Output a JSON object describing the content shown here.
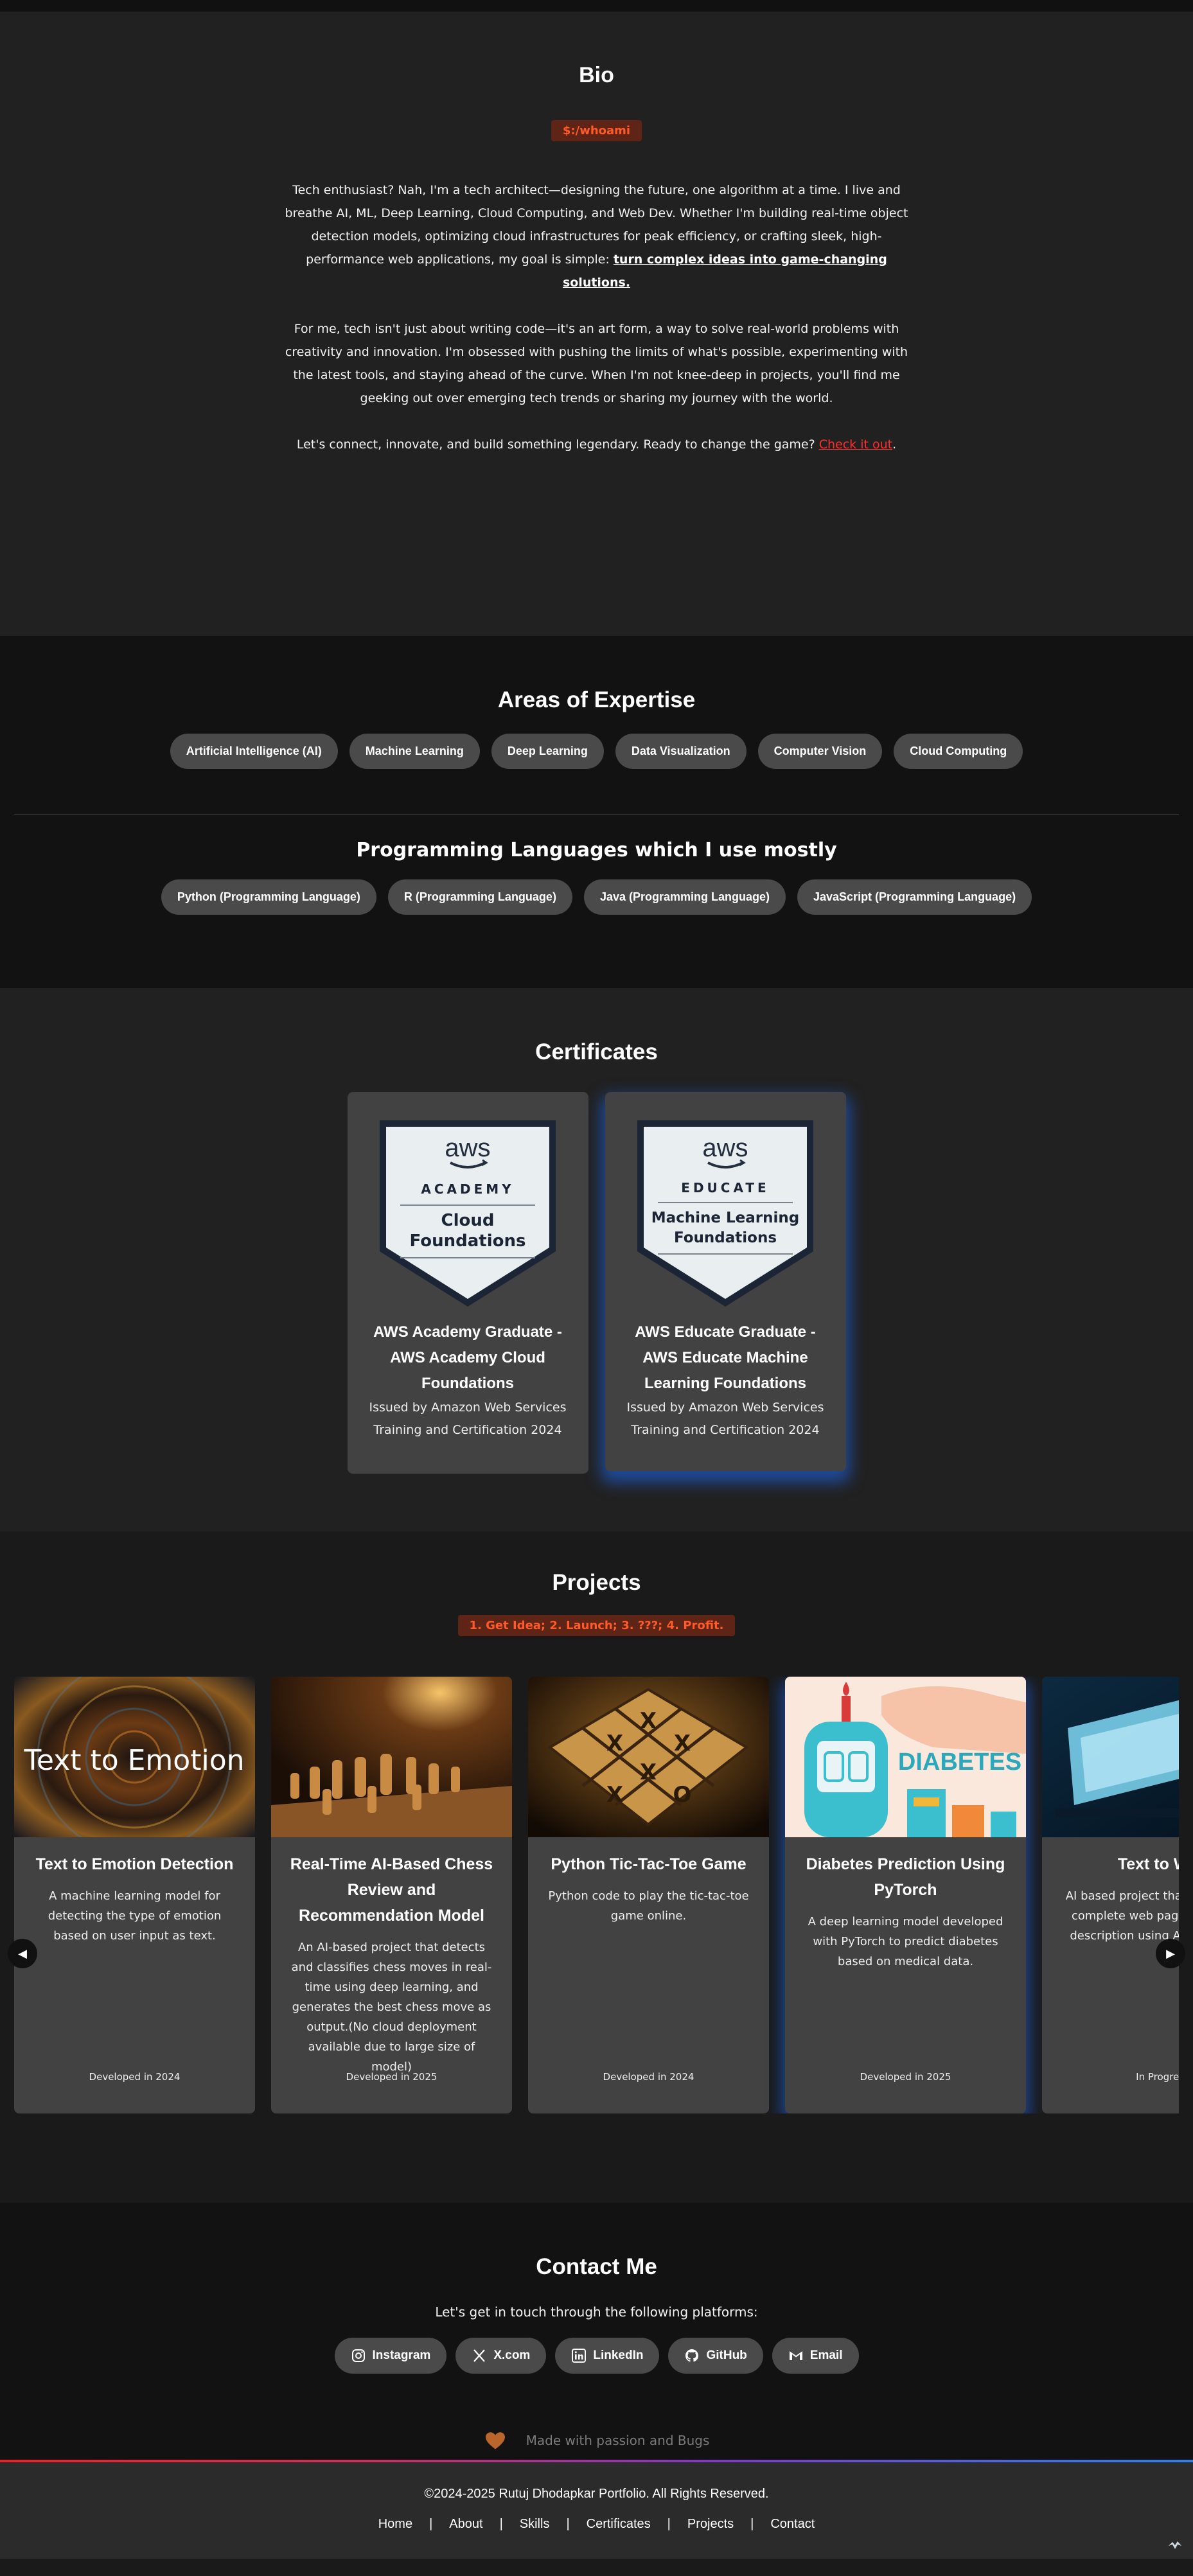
{
  "bio": {
    "title": "Bio",
    "command": "$:/whoami",
    "p1_text": "Tech enthusiast? Nah, I'm a tech architect—designing the future, one algorithm at a time. I live and breathe AI, ML, Deep Learning, Cloud Computing, and Web Dev. Whether I'm building real-time object detection models, optimizing cloud infrastructures for peak efficiency, or crafting sleek, high-performance web applications, my goal is simple: ",
    "p1_link": "turn complex ideas into game-changing solutions.",
    "p2_text": "For me, tech isn't just about writing code—it's an art form, a way to solve real-world problems with creativity and innovation. I'm obsessed with pushing the limits of what's possible, experimenting with the latest tools, and staying ahead of the curve. When I'm not knee-deep in projects, you'll find me geeking out over emerging tech trends or sharing my journey with the world.",
    "p3_text": "Let's connect, innovate, and build something legendary. Ready to change the game? ",
    "p3_link": "Check it out",
    "p3_end": "."
  },
  "expertise": {
    "title": "Areas of Expertise",
    "items": [
      "Artificial Intelligence (AI)",
      "Machine Learning",
      "Deep Learning",
      "Data Visualization",
      "Computer Vision",
      "Cloud Computing"
    ]
  },
  "languages": {
    "title": "Programming Languages which I use mostly",
    "items": [
      "Python (Programming Language)",
      "R (Programming Language)",
      "Java (Programming Language)",
      "JavaScript (Programming Language)"
    ]
  },
  "certificates": {
    "title": "Certificates",
    "items": [
      {
        "badge_brand": "aws",
        "badge_program": "ACADEMY",
        "badge_line1": "Cloud",
        "badge_line2": "Foundations",
        "title": "AWS Academy Graduate - AWS Academy Cloud Foundations",
        "issuer": "Issued by Amazon Web Services Training and Certification 2024"
      },
      {
        "badge_brand": "aws",
        "badge_program": "EDUCATE",
        "badge_line1": "Machine Learning",
        "badge_line2": "Foundations",
        "title": "AWS Educate Graduate - AWS Educate Machine Learning Foundations",
        "issuer": "Issued by Amazon Web Services Training and Certification 2024"
      }
    ]
  },
  "projects": {
    "title": "Projects",
    "command": "1. Get Idea; 2. Launch; 3. ???; 4. Profit.",
    "items": [
      {
        "image_text": "Text to Emotion",
        "title": "Text to Emotion Detection",
        "desc": "A machine learning model for detecting the type of emotion based on user input as text.",
        "date": "Developed in 2024"
      },
      {
        "title": "Real-Time AI-Based Chess Review and Recommendation Model",
        "desc": "An AI-based project that detects and classifies chess moves in real-time using deep learning, and generates the best chess move as output.(No cloud deployment available due to large size of model)",
        "date": "Developed in 2025"
      },
      {
        "title": "Python Tic-Tac-Toe Game",
        "desc": "Python code to play the tic-tac-toe game online.",
        "date": "Developed in 2024"
      },
      {
        "image_text": "DIABETES",
        "title": "Diabetes Prediction Using PyTorch",
        "desc": "A deep learning model developed with PyTorch to predict diabetes based on medical data.",
        "date": "Developed in 2025"
      },
      {
        "title": "Text to Web",
        "desc": "AI based project that generates a complete web page from a text description using AI techniques.",
        "date": "In Progress"
      }
    ],
    "prev_icon": "◀",
    "next_icon": "▶"
  },
  "contact": {
    "title": "Contact Me",
    "subtitle": "Let's get in touch through the following platforms:",
    "buttons": [
      {
        "label": "Instagram",
        "icon": "instagram-icon"
      },
      {
        "label": "X.com",
        "icon": "x-icon"
      },
      {
        "label": "LinkedIn",
        "icon": "linkedin-icon"
      },
      {
        "label": "GitHub",
        "icon": "github-icon"
      },
      {
        "label": "Email",
        "icon": "gmail-icon"
      }
    ],
    "made_with": "Made with passion and Bugs"
  },
  "footer": {
    "copyright": "©2024-2025 Rutuj Dhodapkar Portfolio. All Rights Reserved.",
    "links": [
      "Home",
      "About",
      "Skills",
      "Certificates",
      "Projects",
      "Contact"
    ],
    "separator": "|"
  },
  "colors": {
    "accent_red": "#ff2d2d",
    "code_orange": "#ff5a2a",
    "glow_blue": "#1e6eff"
  }
}
